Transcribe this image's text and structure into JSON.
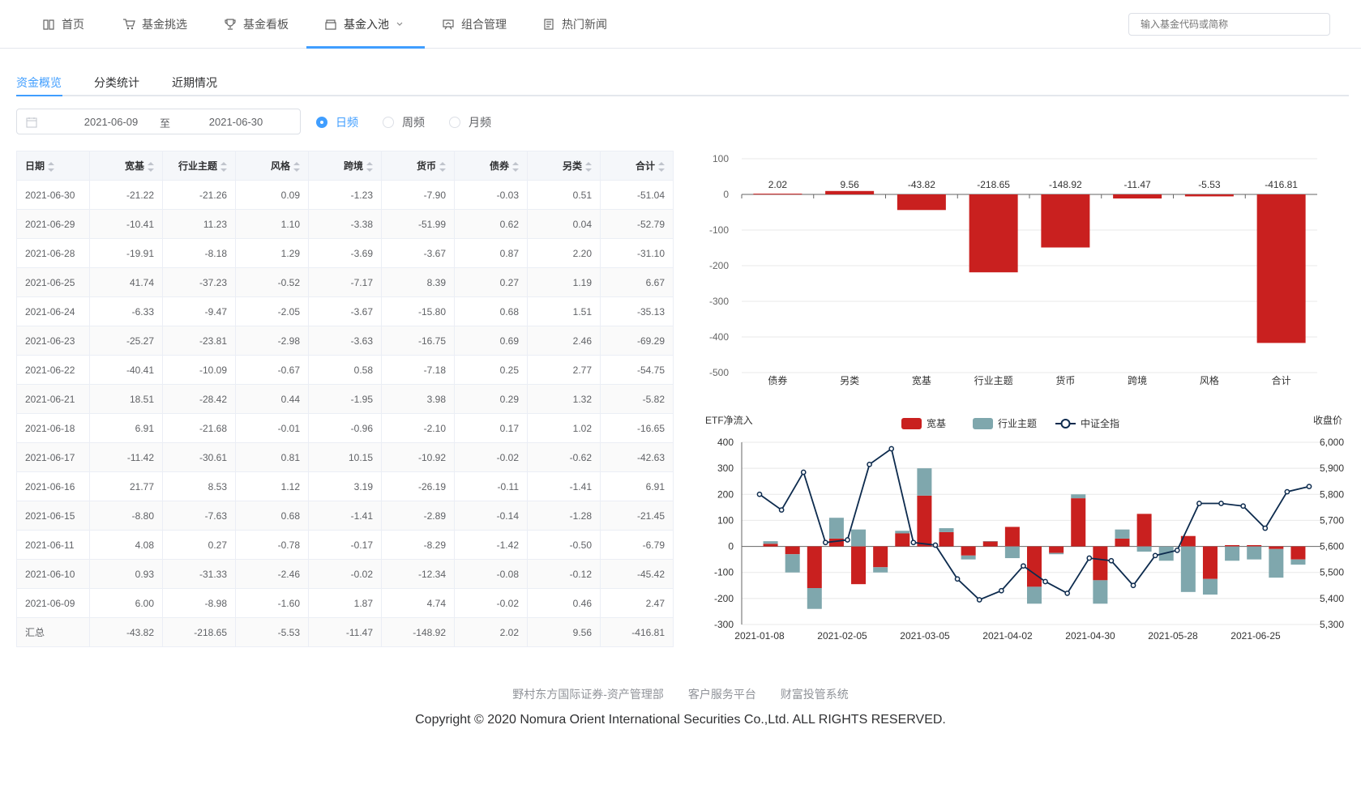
{
  "nav": {
    "items": [
      {
        "label": "首页",
        "icon": "book-icon"
      },
      {
        "label": "基金挑选",
        "icon": "cart-icon"
      },
      {
        "label": "基金看板",
        "icon": "trophy-icon"
      },
      {
        "label": "基金入池",
        "icon": "box-icon"
      },
      {
        "label": "组合管理",
        "icon": "board-icon"
      },
      {
        "label": "热门新闻",
        "icon": "news-icon"
      }
    ],
    "active": "基金入池",
    "search_placeholder": "输入基金代码或简称"
  },
  "subtabs": [
    "资金概览",
    "分类统计",
    "近期情况"
  ],
  "filter": {
    "start_date": "2021-06-09",
    "separator": "至",
    "end_date": "2021-06-30",
    "frequency": [
      "日频",
      "周频",
      "月频"
    ],
    "selected_frequency": "日频"
  },
  "table": {
    "headers": [
      "日期",
      "宽基",
      "行业主题",
      "风格",
      "跨境",
      "货币",
      "债券",
      "另类",
      "合计"
    ],
    "rows": [
      [
        "2021-06-30",
        "-21.22",
        "-21.26",
        "0.09",
        "-1.23",
        "-7.90",
        "-0.03",
        "0.51",
        "-51.04"
      ],
      [
        "2021-06-29",
        "-10.41",
        "11.23",
        "1.10",
        "-3.38",
        "-51.99",
        "0.62",
        "0.04",
        "-52.79"
      ],
      [
        "2021-06-28",
        "-19.91",
        "-8.18",
        "1.29",
        "-3.69",
        "-3.67",
        "0.87",
        "2.20",
        "-31.10"
      ],
      [
        "2021-06-25",
        "41.74",
        "-37.23",
        "-0.52",
        "-7.17",
        "8.39",
        "0.27",
        "1.19",
        "6.67"
      ],
      [
        "2021-06-24",
        "-6.33",
        "-9.47",
        "-2.05",
        "-3.67",
        "-15.80",
        "0.68",
        "1.51",
        "-35.13"
      ],
      [
        "2021-06-23",
        "-25.27",
        "-23.81",
        "-2.98",
        "-3.63",
        "-16.75",
        "0.69",
        "2.46",
        "-69.29"
      ],
      [
        "2021-06-22",
        "-40.41",
        "-10.09",
        "-0.67",
        "0.58",
        "-7.18",
        "0.25",
        "2.77",
        "-54.75"
      ],
      [
        "2021-06-21",
        "18.51",
        "-28.42",
        "0.44",
        "-1.95",
        "3.98",
        "0.29",
        "1.32",
        "-5.82"
      ],
      [
        "2021-06-18",
        "6.91",
        "-21.68",
        "-0.01",
        "-0.96",
        "-2.10",
        "0.17",
        "1.02",
        "-16.65"
      ],
      [
        "2021-06-17",
        "-11.42",
        "-30.61",
        "0.81",
        "10.15",
        "-10.92",
        "-0.02",
        "-0.62",
        "-42.63"
      ],
      [
        "2021-06-16",
        "21.77",
        "8.53",
        "1.12",
        "3.19",
        "-26.19",
        "-0.11",
        "-1.41",
        "6.91"
      ],
      [
        "2021-06-15",
        "-8.80",
        "-7.63",
        "0.68",
        "-1.41",
        "-2.89",
        "-0.14",
        "-1.28",
        "-21.45"
      ],
      [
        "2021-06-11",
        "4.08",
        "0.27",
        "-0.78",
        "-0.17",
        "-8.29",
        "-1.42",
        "-0.50",
        "-6.79"
      ],
      [
        "2021-06-10",
        "0.93",
        "-31.33",
        "-2.46",
        "-0.02",
        "-12.34",
        "-0.08",
        "-0.12",
        "-45.42"
      ],
      [
        "2021-06-09",
        "6.00",
        "-8.98",
        "-1.60",
        "1.87",
        "4.74",
        "-0.02",
        "0.46",
        "2.47"
      ],
      [
        "汇总",
        "-43.82",
        "-218.65",
        "-5.53",
        "-11.47",
        "-148.92",
        "2.02",
        "9.56",
        "-416.81"
      ]
    ]
  },
  "chart_data": [
    {
      "type": "bar",
      "categories": [
        "债券",
        "另类",
        "宽基",
        "行业主题",
        "货币",
        "跨境",
        "风格",
        "合计"
      ],
      "values": [
        2.02,
        9.56,
        -43.82,
        -218.65,
        -148.92,
        -11.47,
        -5.53,
        -416.81
      ],
      "data_labels": [
        "2.02",
        "9.56",
        "-43.82",
        "-218.65",
        "-148.92",
        "-11.47",
        "-5.53",
        "-416.81"
      ],
      "ylim": [
        -500,
        100
      ],
      "yticks": [
        100,
        0,
        -100,
        -200,
        -300,
        -400,
        -500
      ],
      "color": "#c9201f"
    },
    {
      "type": "bar",
      "ylabel": "ETF净流入",
      "y2label": "收盘价",
      "legend": [
        "宽基",
        "行业主题",
        "中证全指"
      ],
      "legend_position": "top-center",
      "colors": {
        "宽基": "#c9201f",
        "行业主题": "#7fa7ad",
        "中证全指": "#0d2b4e"
      },
      "xticks": [
        "2021-01-08",
        "2021-02-05",
        "2021-03-05",
        "2021-04-02",
        "2021-04-30",
        "2021-05-28",
        "2021-06-25"
      ],
      "ylim": [
        -300,
        400
      ],
      "yticks": [
        400,
        300,
        200,
        100,
        0,
        -100,
        -200,
        -300
      ],
      "y2lim": [
        5300,
        6000
      ],
      "y2ticks": [
        "6,000",
        "5,900",
        "5,800",
        "5,700",
        "5,600",
        "5,500",
        "5,400",
        "5,300"
      ],
      "series": [
        {
          "name": "宽基",
          "values": [
            10,
            -30,
            -160,
            30,
            -145,
            -80,
            50,
            195,
            55,
            -35,
            20,
            75,
            -155,
            -25,
            185,
            -130,
            30,
            125,
            0,
            40,
            -125,
            5,
            5,
            -10,
            -50
          ]
        },
        {
          "name": "行业主题",
          "values": [
            10,
            -70,
            -80,
            80,
            65,
            -20,
            10,
            105,
            15,
            -15,
            0,
            -45,
            -65,
            -5,
            15,
            -90,
            35,
            -20,
            -55,
            -175,
            -60,
            -55,
            -50,
            -110,
            -20
          ]
        },
        {
          "name": "中证全指",
          "values": [
            5800,
            5740,
            5885,
            5615,
            5625,
            5915,
            5975,
            5615,
            5605,
            5475,
            5395,
            5430,
            5525,
            5465,
            5420,
            5555,
            5545,
            5450,
            5565,
            5585,
            5765,
            5765,
            5755,
            5670,
            5810,
            5830
          ]
        }
      ]
    }
  ],
  "footer": {
    "links": [
      "野村东方国际证券-资产管理部",
      "客户服务平台",
      "财富投管系统"
    ],
    "copyright": "Copyright © 2020 Nomura Orient International Securities Co.,Ltd. ALL RIGHTS RESERVED."
  }
}
